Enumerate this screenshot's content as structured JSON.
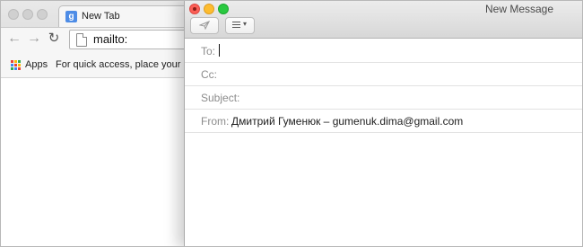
{
  "browser": {
    "tab": {
      "title": "New Tab",
      "favicon": "google-g-icon",
      "favicon_letter": "g"
    },
    "omnibox": {
      "value": "mailto:"
    },
    "bookmarks": {
      "apps_label": "Apps",
      "hint": "For quick access, place your book"
    }
  },
  "mail": {
    "title": "New Message",
    "toolbar": {
      "send_icon": "paper-plane-icon",
      "format_icon": "list-icon"
    },
    "fields": {
      "to": {
        "label": "To:",
        "value": ""
      },
      "cc": {
        "label": "Cc:",
        "value": ""
      },
      "subject": {
        "label": "Subject:",
        "value": ""
      },
      "from": {
        "label": "From:",
        "value": "Дмитрий Гуменюк – gumenuk.dima@gmail.com"
      }
    }
  },
  "colors": {
    "close": "#fb5f57",
    "minimize": "#fdbc2f",
    "zoom": "#29c940",
    "favicon": "#4d8ce6"
  }
}
